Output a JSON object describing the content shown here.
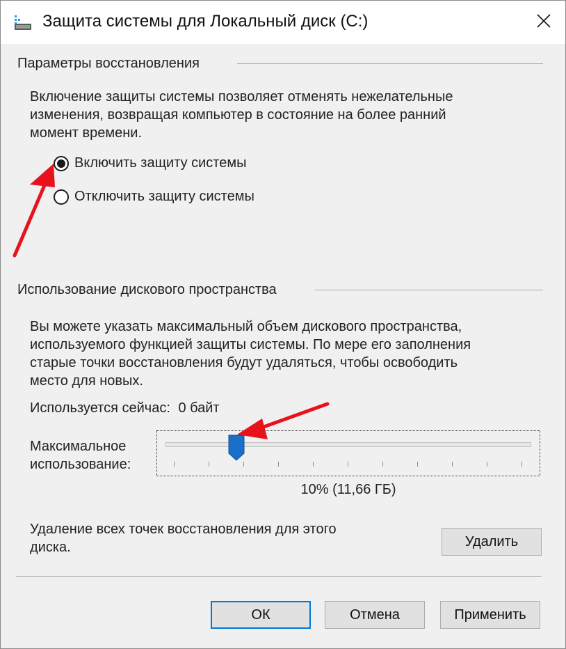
{
  "window": {
    "title": "Защита системы для Локальный диск (C:)"
  },
  "restore_settings": {
    "group_label": "Параметры восстановления",
    "description_lines": [
      "Включение защиты системы позволяет отменять нежелательные",
      "изменения, возвращая компьютер в состояние на более ранний",
      "момент времени."
    ],
    "options": [
      {
        "label": "Включить защиту системы",
        "selected": true
      },
      {
        "label": "Отключить защиту системы",
        "selected": false
      }
    ]
  },
  "disk_usage": {
    "group_label": "Использование дискового пространства",
    "description_lines": [
      "Вы можете указать максимальный объем дискового пространства,",
      "используемого функцией защиты системы. По мере его заполнения",
      "старые точки восстановления будут удаляться, чтобы освободить",
      "место для новых."
    ],
    "current_usage_label": "Используется сейчас:",
    "current_usage_value": "0 байт",
    "max_usage_label_lines": [
      "Максимальное",
      "использование:"
    ],
    "slider_percent": 10,
    "slider_value_text": "10% (11,66 ГБ)",
    "delete_description_lines": [
      "Удаление всех точек восстановления для этого",
      "диска."
    ],
    "delete_button_label": "Удалить"
  },
  "footer": {
    "ok_label": "ОК",
    "cancel_label": "Отмена",
    "apply_label": "Применить"
  },
  "colors": {
    "accent": "#0078d7",
    "slider_thumb": "#1a6fc9",
    "annotation_arrow": "#e8121c"
  },
  "icons": {
    "title": "system-protection-drive-icon",
    "close": "close-icon"
  }
}
